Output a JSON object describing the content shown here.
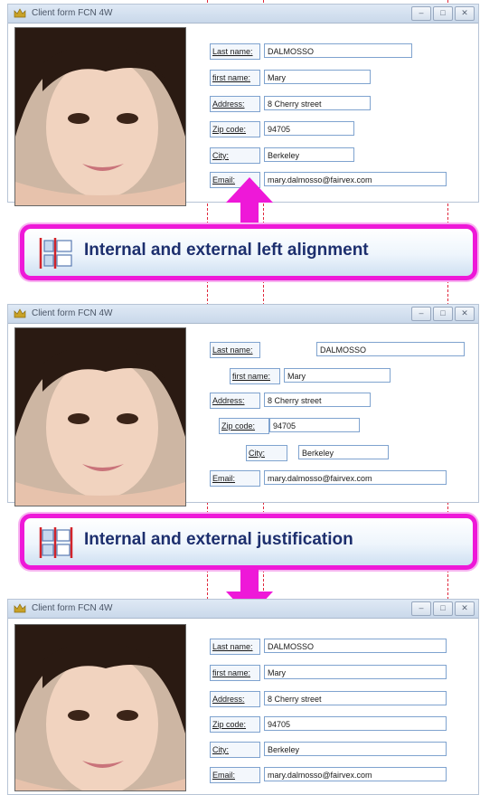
{
  "window": {
    "title": "Client form FCN 4W",
    "buttons": {
      "minimize": "–",
      "maximize": "□",
      "close": "✕"
    }
  },
  "form": {
    "labels": {
      "last_name": "Last name:",
      "first_name": "first name:",
      "address": "Address:",
      "zip_code": "Zip code:",
      "city": "City:",
      "email": "Email:"
    },
    "values": {
      "last_name": "DALMOSSO",
      "first_name": "Mary",
      "address": "8 Cherry street",
      "zip_code": "94705",
      "city": "Berkeley",
      "email": "mary.dalmosso@fairvex.com"
    }
  },
  "banners": {
    "left_alignment": "Internal and external left alignment",
    "justification": "Internal and external justification"
  },
  "colors": {
    "banner_border": "#ee18d8",
    "banner_text": "#1d2f6e",
    "guide_line": "#e0283c",
    "field_border": "#7fa3cf",
    "arrow": "#ee18d8"
  }
}
